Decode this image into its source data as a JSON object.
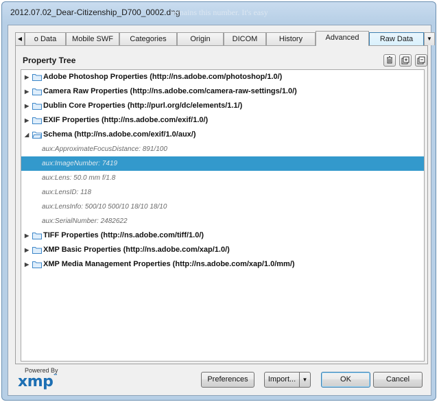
{
  "window": {
    "title": "2012.07.02_Dear-Citizenship_D700_0002.dng",
    "background_text": "remains this number. It's easy"
  },
  "tabs": {
    "items": [
      {
        "label": "o Data"
      },
      {
        "label": "Mobile SWF"
      },
      {
        "label": "Categories"
      },
      {
        "label": "Origin"
      },
      {
        "label": "DICOM"
      },
      {
        "label": "History"
      },
      {
        "label": "Advanced",
        "active": true
      },
      {
        "label": "Raw Data"
      }
    ]
  },
  "panel": {
    "title": "Property Tree",
    "tools": [
      "delete-icon",
      "expand-all-icon",
      "collapse-all-icon"
    ]
  },
  "tree": {
    "rows": [
      {
        "type": "group",
        "expanded": false,
        "label": "Adobe Photoshop Properties (http://ns.adobe.com/photoshop/1.0/)"
      },
      {
        "type": "group",
        "expanded": false,
        "label": "Camera Raw Properties (http://ns.adobe.com/camera-raw-settings/1.0/)"
      },
      {
        "type": "group",
        "expanded": false,
        "label": "Dublin Core Properties (http://purl.org/dc/elements/1.1/)"
      },
      {
        "type": "group",
        "expanded": false,
        "label": "EXIF Properties (http://ns.adobe.com/exif/1.0/)"
      },
      {
        "type": "group",
        "expanded": true,
        "label": "Schema (http://ns.adobe.com/exif/1.0/aux/)"
      },
      {
        "type": "prop",
        "label": "aux:ApproximateFocusDistance: 891/100"
      },
      {
        "type": "prop",
        "label": "aux:ImageNumber: 7419",
        "selected": true
      },
      {
        "type": "prop",
        "label": "aux:Lens: 50.0 mm f/1.8"
      },
      {
        "type": "prop",
        "label": "aux:LensID: 118"
      },
      {
        "type": "prop",
        "label": "aux:LensInfo: 500/10 500/10 18/10 18/10"
      },
      {
        "type": "prop",
        "label": "aux:SerialNumber: 2482622"
      },
      {
        "type": "group",
        "expanded": false,
        "label": "TIFF Properties (http://ns.adobe.com/tiff/1.0/)"
      },
      {
        "type": "group",
        "expanded": false,
        "label": "XMP Basic Properties (http://ns.adobe.com/xap/1.0/)"
      },
      {
        "type": "group",
        "expanded": false,
        "label": "XMP Media Management Properties (http://ns.adobe.com/xap/1.0/mm/)"
      }
    ]
  },
  "footer": {
    "powered_by": "Powered By",
    "logo": "xmp",
    "buttons": {
      "preferences": "Preferences",
      "import": "Import...",
      "ok": "OK",
      "cancel": "Cancel"
    }
  },
  "colors": {
    "selection": "#3399cc",
    "folder": "#3c86c8",
    "logo": "#1d6fb3"
  }
}
